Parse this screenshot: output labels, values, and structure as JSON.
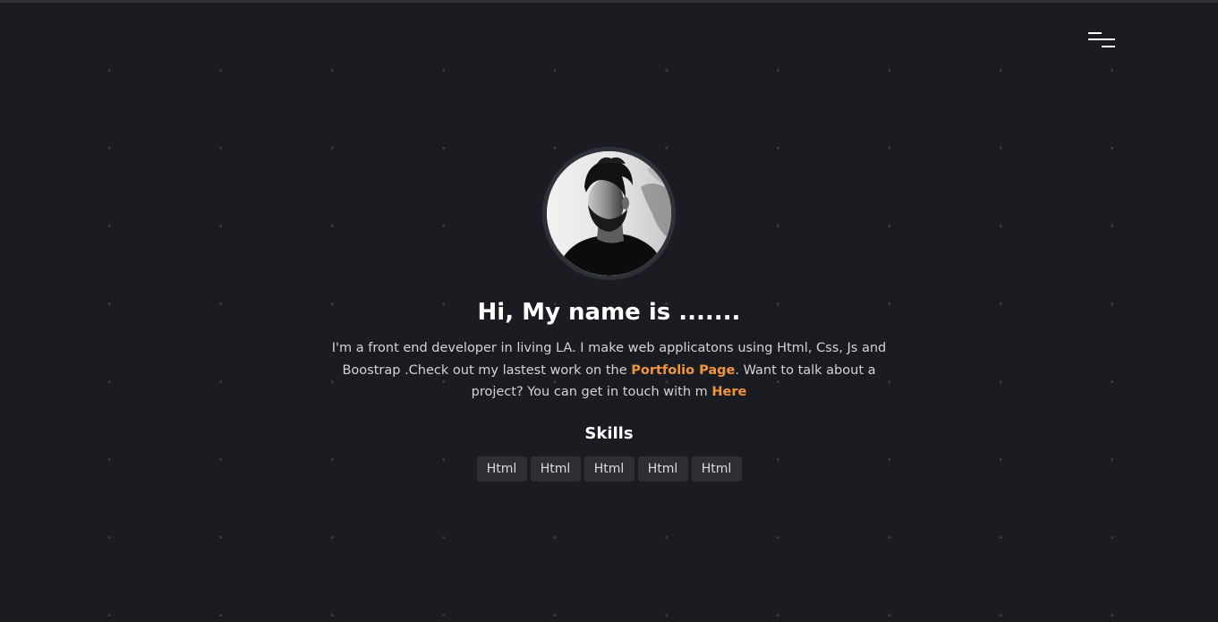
{
  "header": {
    "menu_icon": "hamburger-menu-icon"
  },
  "hero": {
    "avatar_icon": "profile-photo",
    "title": "Hi, My name is .......",
    "bio": {
      "part1": "I'm a front end developer in living LA. I make web applicatons using Html, Css, Js and Boostrap .Check out my lastest work on the ",
      "portfolio_link": "Portfolio Page",
      "part2": ". Want to talk about a project? You can get in touch with m ",
      "here_link": "Here"
    },
    "skills_heading": "Skills",
    "skills": [
      "Html",
      "Html",
      "Html",
      "Html",
      "Html"
    ]
  },
  "colors": {
    "background": "#1b1c21",
    "accent": "#f0963d",
    "tag_background": "#2e2f35",
    "avatar_border": "#2f3138"
  }
}
